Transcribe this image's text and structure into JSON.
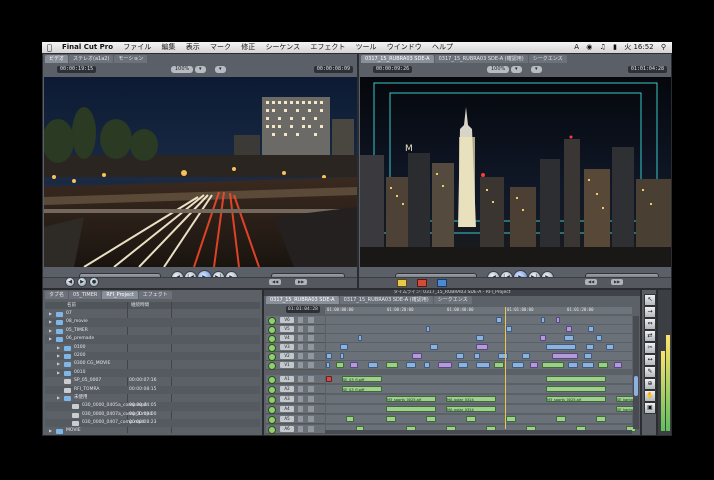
{
  "menubar": {
    "apple_icon": "apple-icon",
    "app_name": "Final Cut Pro",
    "items": [
      "ファイル",
      "編集",
      "表示",
      "マーク",
      "修正",
      "シーケンス",
      "エフェクト",
      "ツール",
      "ウインドウ",
      "ヘルプ"
    ],
    "clock": "火 16:52"
  },
  "viewer": {
    "tabs": [
      "ビデオ",
      "ステレオ(a1a2)",
      "モーション"
    ],
    "timecode_left": "00:00:19:15",
    "timecode_right": "00:00:08:09",
    "zoom_label": "100%"
  },
  "canvas": {
    "tabs": [
      "0317_15_RUBRA03 SDE-A",
      "0317_15_RUBRA03 SDE-A (確認用)",
      "シークエンス"
    ],
    "timecode_left": "00:00:09:26",
    "timecode_right": "01:01:04:28",
    "zoom_label": "100%"
  },
  "browser": {
    "tabs": [
      "タブ名",
      "05_TIMER",
      "RFI_Project",
      "エフェクト"
    ],
    "columns": [
      "名前",
      "継続時間"
    ],
    "rows": [
      {
        "name": "07",
        "duration": "",
        "indent": 0,
        "type": "bin"
      },
      {
        "name": "08_movie",
        "duration": "",
        "indent": 0,
        "type": "bin"
      },
      {
        "name": "05_TIMER",
        "duration": "",
        "indent": 0,
        "type": "bin"
      },
      {
        "name": "06_premade",
        "duration": "",
        "indent": 0,
        "type": "bin"
      },
      {
        "name": "0100",
        "duration": "",
        "indent": 1,
        "type": "bin"
      },
      {
        "name": "0200",
        "duration": "",
        "indent": 1,
        "type": "bin"
      },
      {
        "name": "0300 CG_MOVIE",
        "duration": "",
        "indent": 1,
        "type": "bin"
      },
      {
        "name": "0010",
        "duration": "",
        "indent": 1,
        "type": "bin"
      },
      {
        "name": "SP_05_0007",
        "duration": "00:00:07:16",
        "indent": 1,
        "type": "clip"
      },
      {
        "name": "RFI_TOMRA",
        "duration": "00:00:08:15",
        "indent": 1,
        "type": "clip"
      },
      {
        "name": "未使用",
        "duration": "",
        "indent": 1,
        "type": "bin"
      },
      {
        "name": "030_0000_0405a_comp.mp4",
        "duration": "00:00:04:05",
        "indent": 2,
        "type": "clip"
      },
      {
        "name": "030_0000_0407a_comp_1.mp4",
        "duration": "00:00:09:00",
        "indent": 2,
        "type": "clip"
      },
      {
        "name": "030_0000_0407_comp.mp4",
        "duration": "00:00:08:23",
        "indent": 2,
        "type": "clip"
      },
      {
        "name": "MOVIE",
        "duration": "",
        "indent": 0,
        "type": "bin"
      }
    ]
  },
  "timeline": {
    "title": "タイムライン: 0317_15_RUBRA03 SDE-A - RFI_Project",
    "tabs": [
      "0317_15_RUBRA03 SDE-A",
      "0317_15_RUBRA03 SDE-A (確認用)",
      "シークエンス"
    ],
    "timecode": "01:01:04:28",
    "ruler_labels": [
      "01:00:00:00",
      "01:00:20:00",
      "01:00:40:00",
      "01:01:00:00",
      "01:01:20:00"
    ],
    "video_tracks": [
      "V6",
      "V5",
      "V4",
      "V3",
      "V2",
      "V1"
    ],
    "audio_tracks": [
      "A1",
      "A2",
      "A3",
      "A4",
      "A5",
      "A6",
      "A7",
      "A8"
    ],
    "audio_clip_labels": [
      "SE_03_fl.aiff",
      "SE_03_fl.aiff",
      "M3_sports_0025.aif",
      "M3_sports_0025.aif",
      "MA_polar_0324",
      "MA_polar_0324",
      "SE_kanta_03.aif",
      "SE_kanta_03.aif"
    ]
  },
  "tools": [
    "arrow-tool-icon",
    "track-select-icon",
    "ripple-tool-icon",
    "roll-tool-icon",
    "razor-tool-icon",
    "slip-tool-icon",
    "pen-tool-icon",
    "zoom-tool-icon",
    "hand-tool-icon",
    "crop-tool-icon"
  ]
}
